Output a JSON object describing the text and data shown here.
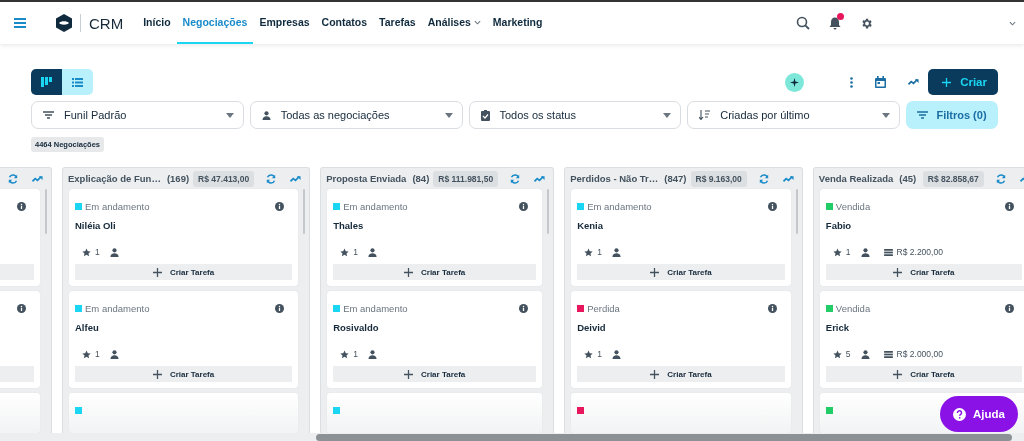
{
  "topbar": {
    "logo_text": "CRM",
    "notification_dot": true,
    "nav": [
      {
        "label": "Início",
        "selected": false,
        "has_menu": false
      },
      {
        "label": "Negociações",
        "selected": true,
        "has_menu": false
      },
      {
        "label": "Empresas",
        "selected": false,
        "has_menu": false
      },
      {
        "label": "Contatos",
        "selected": false,
        "has_menu": false
      },
      {
        "label": "Tarefas",
        "selected": false,
        "has_menu": false
      },
      {
        "label": "Análises",
        "selected": false,
        "has_menu": true
      },
      {
        "label": "Marketing",
        "selected": false,
        "has_menu": false
      }
    ]
  },
  "view_toggle": [
    {
      "kind": "board",
      "selected": true
    },
    {
      "kind": "list",
      "selected": false
    }
  ],
  "create_label": "Criar",
  "filters": [
    {
      "kind": "funnel",
      "value": "Funil Padrão"
    },
    {
      "kind": "person",
      "value": "Todas as negociações"
    },
    {
      "kind": "status",
      "value": "Todos os status"
    },
    {
      "kind": "sort",
      "value": "Criadas por último"
    }
  ],
  "filters_button": "Filtros (0)",
  "deal_count": "4464 Negociações",
  "columns": [
    {
      "kind": "partial",
      "cards": [
        {
          "kind": "cut"
        },
        {
          "kind": "cut"
        },
        {
          "kind": "peek"
        }
      ]
    },
    {
      "kind": "full",
      "title": "Explicação de Fun…",
      "count": "(169)",
      "total": "R$ 47.413,00",
      "cards": [
        {
          "kind": "deal",
          "status": "Em andamento",
          "color": "#1ad6f2",
          "name": "Niléia Oli",
          "score": "1",
          "task_label": "Criar Tarefa"
        },
        {
          "kind": "deal",
          "status": "Em andamento",
          "color": "#1ad6f2",
          "name": "Alfeu",
          "score": "1",
          "task_label": "Criar Tarefa"
        },
        {
          "kind": "peek",
          "color": "#1ad6f2"
        }
      ]
    },
    {
      "kind": "full",
      "title": "Proposta Enviada",
      "count": "(84)",
      "total": "R$ 111.981,50",
      "cards": [
        {
          "kind": "deal",
          "status": "Em andamento",
          "color": "#1ad6f2",
          "name": "Thales",
          "score": "1",
          "task_label": "Criar Tarefa"
        },
        {
          "kind": "deal",
          "status": "Em andamento",
          "color": "#1ad6f2",
          "name": "Rosivaldo",
          "score": "1",
          "task_label": "Criar Tarefa"
        },
        {
          "kind": "peek",
          "color": "#1ad6f2"
        }
      ]
    },
    {
      "kind": "full",
      "title": "Perdidos - Não Tr…",
      "count": "(847)",
      "total": "R$ 9.163,00",
      "cards": [
        {
          "kind": "deal",
          "status": "Em andamento",
          "color": "#1ad6f2",
          "name": "Kenia",
          "score": "1",
          "task_label": "Criar Tarefa"
        },
        {
          "kind": "deal",
          "status": "Perdida",
          "color": "#e8175d",
          "name": "Deivid",
          "score": "1",
          "task_label": "Criar Tarefa"
        },
        {
          "kind": "peek",
          "color": "#e8175d"
        }
      ]
    },
    {
      "kind": "full",
      "title": "Venda Realizada",
      "count": "(45)",
      "total": "R$ 82.858,67",
      "cards": [
        {
          "kind": "deal",
          "status": "Vendida",
          "color": "#22cc66",
          "name": "Fabio",
          "score": "1",
          "value": "R$ 2.200,00",
          "task_label": "Criar Tarefa"
        },
        {
          "kind": "deal",
          "status": "Vendida",
          "color": "#22cc66",
          "name": "Erick",
          "score": "5",
          "value": "R$ 2.000,00",
          "task_label": "Criar Tarefa"
        },
        {
          "kind": "peek",
          "color": "#22cc66"
        }
      ]
    }
  ],
  "help_button": "Ajuda"
}
